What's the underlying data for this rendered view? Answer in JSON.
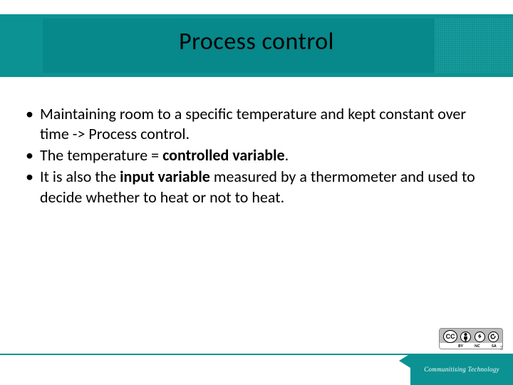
{
  "slide": {
    "title": "Process control",
    "bullets": [
      {
        "pre": "Maintaining room to a specific temperature and kept constant over time -> Process control.",
        "bold": "",
        "post": ""
      },
      {
        "pre": "The temperature = ",
        "bold": "controlled variable",
        "post": "."
      },
      {
        "pre": "It is also the ",
        "bold": "input variable",
        "post": " measured by a thermometer and used to decide whether to heat or not to heat."
      }
    ],
    "number": "3"
  },
  "footer": {
    "brand": "Communitising Technology"
  },
  "cc": {
    "main": "CC",
    "by_symbol": "⬤",
    "nc_symbol": "$",
    "labels": {
      "cc": "",
      "by": "BY",
      "nc": "NC",
      "sa": "SA"
    }
  }
}
